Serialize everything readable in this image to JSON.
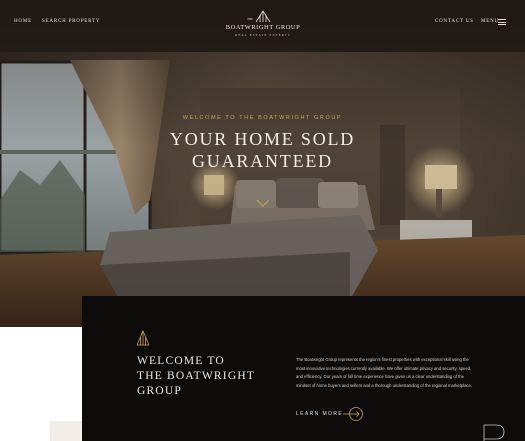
{
  "nav": {
    "home": "HOME",
    "search": "SEARCH PROPERTY",
    "contact": "CONTACT US",
    "menu": "MENU"
  },
  "logo": {
    "name": "BOATWRIGHT GROUP",
    "the": "THE",
    "tagline": "REAL ESTATE EXPERTS"
  },
  "hero": {
    "eyebrow": "WELCOME TO THE BOATWRIGHT GROUP",
    "title_line1": "YOUR HOME SOLD",
    "title_line2": "GUARANTEED"
  },
  "welcome": {
    "title_line1": "WELCOME TO",
    "title_line2": "THE BOATWRIGHT",
    "title_line3": "GROUP",
    "body": "The Boatwright Group represents the region's finest properties with exceptional skill using the most innovative technologies currently available. We offer ultimate privacy and security, speed, and efficiency. Our years of full time experience have given us a clear understanding of the mindset of home buyers and sellers and a thorough understanding of the regional marketplace.",
    "learn_more": "LEARN MORE"
  },
  "colors": {
    "accent_gold": "#c9a25a",
    "panel": "#0d0c0b",
    "text_light": "#efe9df"
  },
  "icons": {
    "logo": "building-columns-logo",
    "chevron": "chevron-down-icon",
    "menu": "hamburger-icon",
    "arrow": "arrow-right-circle-icon"
  }
}
